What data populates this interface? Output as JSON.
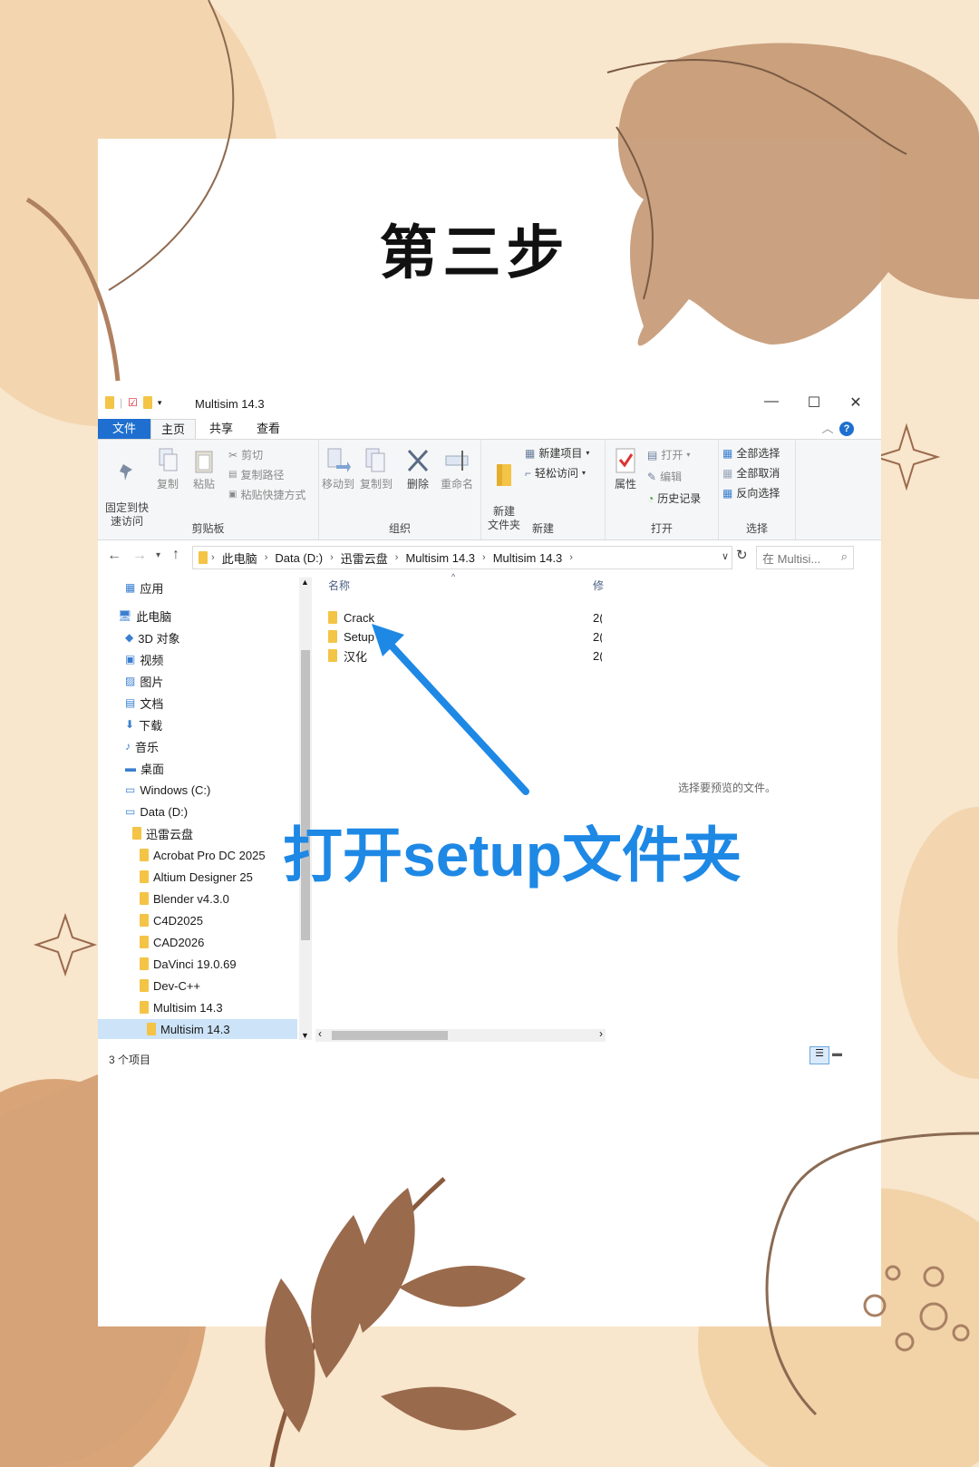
{
  "page": {
    "title": "第三步",
    "annotation": "打开setup文件夹"
  },
  "window": {
    "title": "Multisim 14.3",
    "tabs": [
      "文件",
      "主页",
      "共享",
      "查看"
    ],
    "help": "?"
  },
  "ribbon": {
    "clipboard": {
      "group": "剪贴板",
      "pin": "固定到快\n速访问",
      "copy": "复制",
      "paste": "粘贴",
      "cut": "剪切",
      "copy_path": "复制路径",
      "paste_shortcut": "粘贴快捷方式"
    },
    "organize": {
      "group": "组织",
      "move_to": "移动到",
      "copy_to": "复制到",
      "delete": "删除",
      "rename": "重命名"
    },
    "new": {
      "group": "新建",
      "new_folder": "新建\n文件夹",
      "new_item": "新建项目",
      "easy_access": "轻松访问"
    },
    "open": {
      "group": "打开",
      "properties": "属性",
      "open": "打开",
      "edit": "编辑",
      "history": "历史记录"
    },
    "select": {
      "group": "选择",
      "select_all": "全部选择",
      "select_none": "全部取消",
      "invert": "反向选择"
    }
  },
  "address": {
    "crumbs": [
      "此电脑",
      "Data (D:)",
      "迅雷云盘",
      "Multisim 14.3",
      "Multisim 14.3"
    ],
    "search_placeholder": "在 Multisi..."
  },
  "nav": [
    {
      "label": "应用",
      "icon": "app-icon",
      "indent": 1
    },
    {
      "label": "此电脑",
      "icon": "pc-icon",
      "indent": 0
    },
    {
      "label": "3D 对象",
      "icon": "cube-icon",
      "indent": 1
    },
    {
      "label": "视频",
      "icon": "video-icon",
      "indent": 1
    },
    {
      "label": "图片",
      "icon": "picture-icon",
      "indent": 1
    },
    {
      "label": "文档",
      "icon": "document-icon",
      "indent": 1
    },
    {
      "label": "下载",
      "icon": "download-icon",
      "indent": 1
    },
    {
      "label": "音乐",
      "icon": "music-icon",
      "indent": 1
    },
    {
      "label": "桌面",
      "icon": "desktop-icon",
      "indent": 1
    },
    {
      "label": "Windows (C:)",
      "icon": "drive-icon",
      "indent": 1
    },
    {
      "label": "Data (D:)",
      "icon": "drive-icon",
      "indent": 1
    },
    {
      "label": "迅雷云盘",
      "icon": "folder-icon",
      "indent": 2
    },
    {
      "label": "Acrobat Pro DC 2025",
      "icon": "folder-icon",
      "indent": 3
    },
    {
      "label": "Altium Designer 25",
      "icon": "folder-icon",
      "indent": 3
    },
    {
      "label": "Blender v4.3.0",
      "icon": "folder-icon",
      "indent": 3
    },
    {
      "label": "C4D2025",
      "icon": "folder-icon",
      "indent": 3
    },
    {
      "label": "CAD2026",
      "icon": "folder-icon",
      "indent": 3
    },
    {
      "label": "DaVinci 19.0.69",
      "icon": "folder-icon",
      "indent": 3
    },
    {
      "label": "Dev-C++",
      "icon": "folder-icon",
      "indent": 3
    },
    {
      "label": "Multisim 14.3",
      "icon": "folder-icon",
      "indent": 3
    },
    {
      "label": "Multisim 14.3",
      "icon": "folder-icon",
      "indent": 4,
      "selected": true
    }
  ],
  "list": {
    "col_name": "名称",
    "col_modified": "修",
    "files": [
      {
        "name": "Crack",
        "date": "2("
      },
      {
        "name": "Setup",
        "date": "2("
      },
      {
        "name": "汉化",
        "date": "2("
      }
    ]
  },
  "preview_text": "选择要预览的文件。",
  "status": "3 个项目",
  "colors": {
    "accent": "#1e6fcf",
    "annotation": "#1e88e5",
    "background": "#f8e6cd",
    "leaf": "#c9a07c"
  }
}
